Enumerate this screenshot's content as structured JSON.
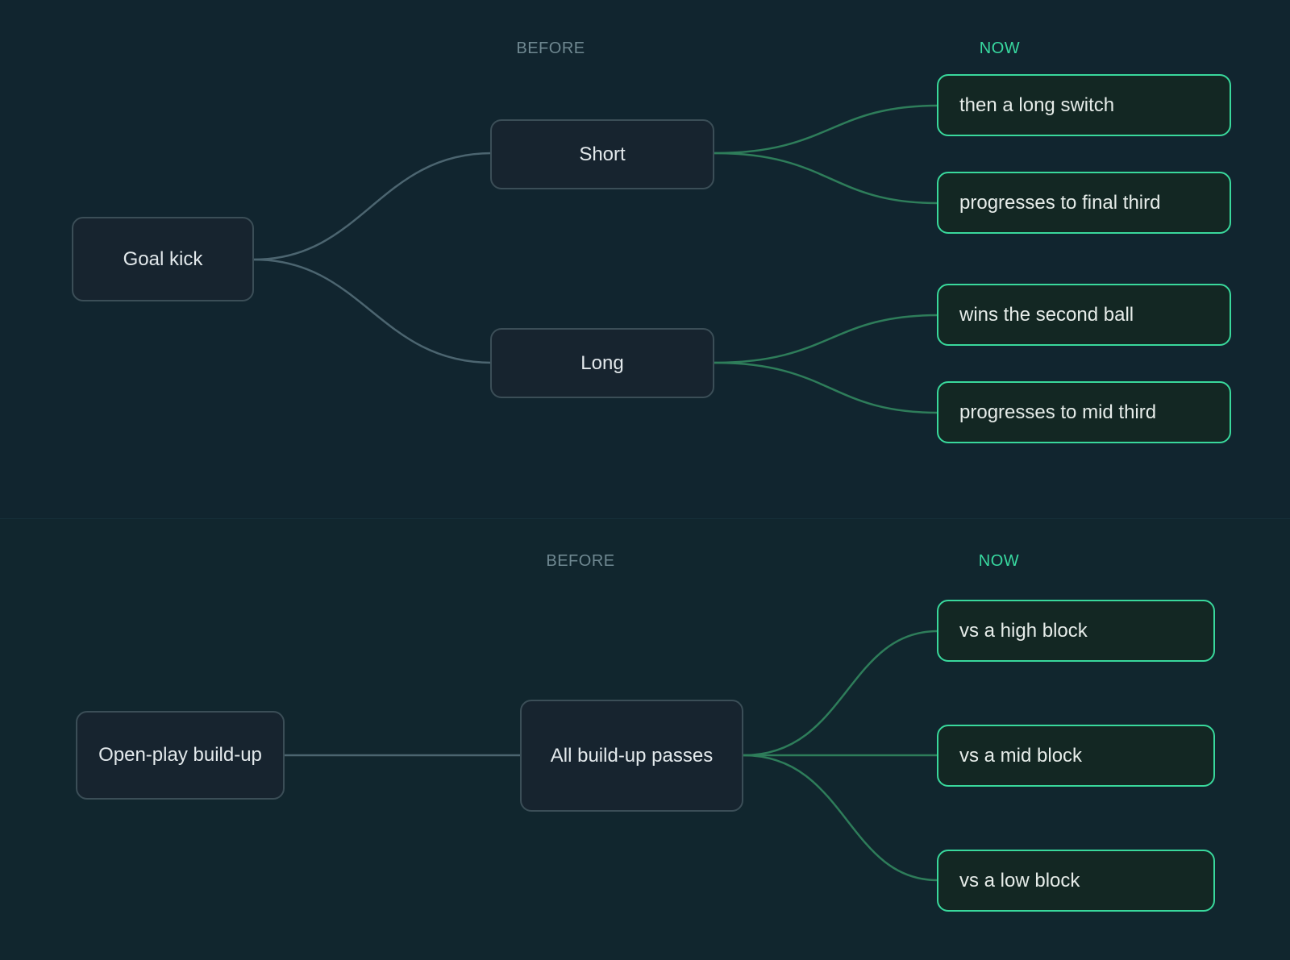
{
  "diagrams": [
    {
      "before_label": "BEFORE",
      "now_label": "NOW",
      "root": "Goal kick",
      "branches": [
        {
          "label": "Short",
          "outcomes": [
            "then a long switch",
            "progresses to final third"
          ]
        },
        {
          "label": "Long",
          "outcomes": [
            "wins the second ball",
            "progresses to mid third"
          ]
        }
      ]
    },
    {
      "before_label": "BEFORE",
      "now_label": "NOW",
      "root": "Open-play build-up",
      "branches": [
        {
          "label": "All build-up passes",
          "outcomes": [
            "vs a high block",
            "vs a mid block",
            "vs a low block"
          ]
        }
      ]
    }
  ],
  "colors": {
    "background": "#11252e",
    "before_border": "#3b4e57",
    "now_border": "#39d89c",
    "before_link": "#4c6570",
    "now_link": "#2e7d5a"
  }
}
